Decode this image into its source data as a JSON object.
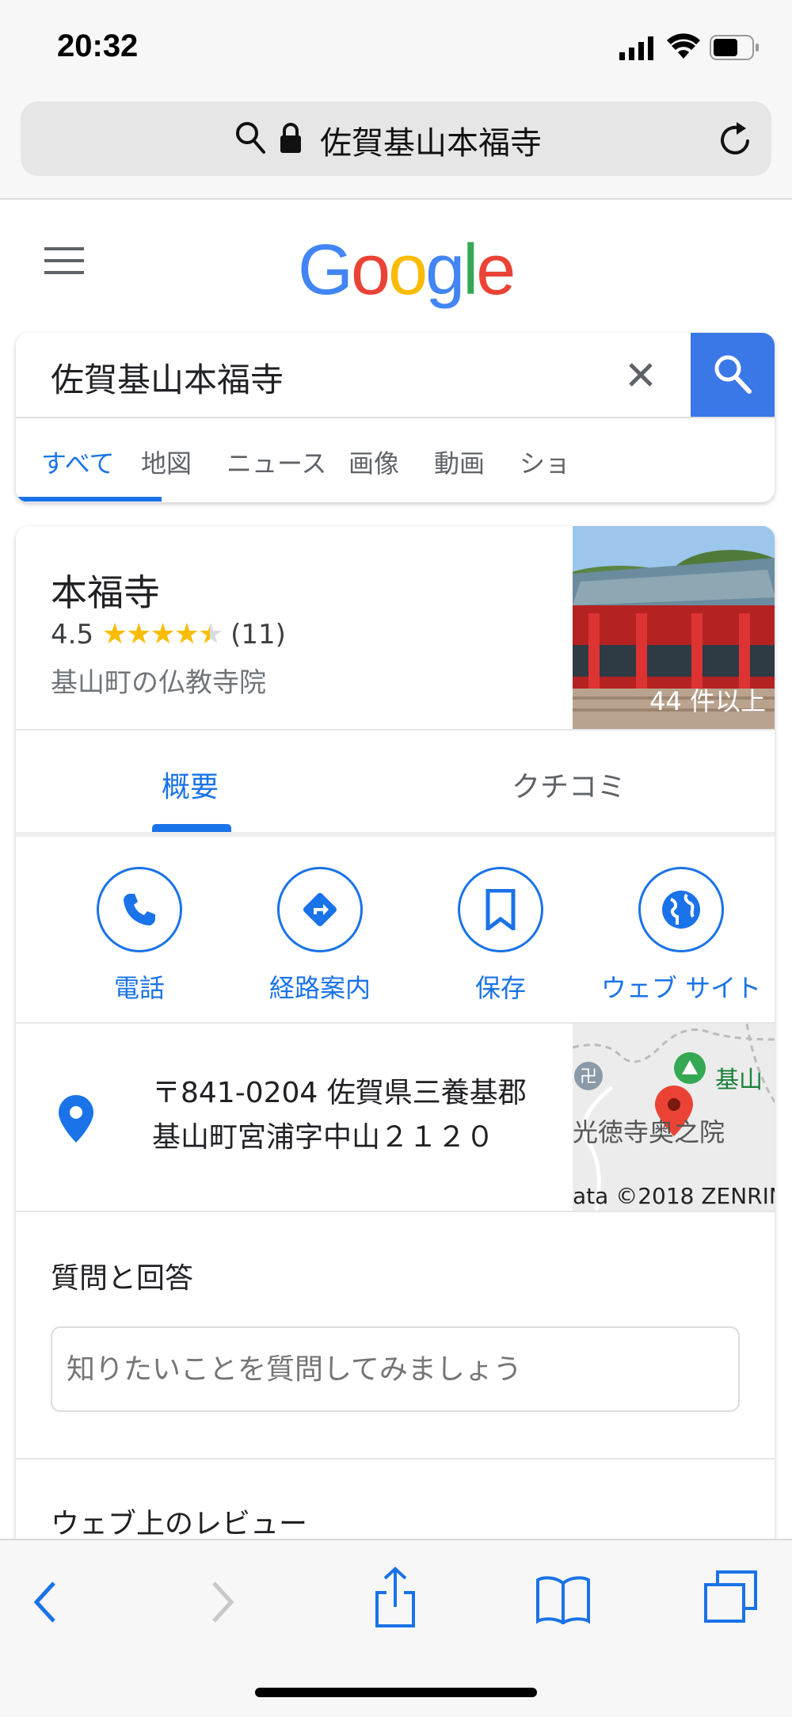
{
  "status": {
    "time": "20:32"
  },
  "browser": {
    "url_text": "佐賀基山本福寺"
  },
  "google": {
    "logo_letters": [
      "G",
      "o",
      "o",
      "g",
      "l",
      "e"
    ],
    "logo_colors": [
      "#4285F4",
      "#EA4335",
      "#FBBC05",
      "#4285F4",
      "#34A853",
      "#EA4335"
    ]
  },
  "search": {
    "query": "佐賀基山本福寺",
    "tabs": [
      {
        "label": "すべて",
        "active": true
      },
      {
        "label": "地図"
      },
      {
        "label": "ニュース"
      },
      {
        "label": "画像"
      },
      {
        "label": "動画"
      },
      {
        "label": "ショ"
      }
    ]
  },
  "entity": {
    "title": "本福寺",
    "rating": "4.5",
    "rating_stars": 4.5,
    "review_count": "(11)",
    "subtitle": "基山町の仏教寺院",
    "photo_count": "44 件以上",
    "subtabs": [
      {
        "label": "概要",
        "active": true
      },
      {
        "label": "クチコミ"
      }
    ],
    "actions": [
      {
        "label": "電話",
        "icon": "phone-icon"
      },
      {
        "label": "経路案内",
        "icon": "directions-icon"
      },
      {
        "label": "保存",
        "icon": "bookmark-icon"
      },
      {
        "label": "ウェブ サイト",
        "icon": "globe-icon"
      }
    ],
    "address_line1": "〒841-0204 佐賀県三養基郡",
    "address_line2": "基山町宮浦字中山２１２０",
    "map": {
      "label1": "基山",
      "label2": "光徳寺奥之院",
      "copyright": "ata ©2018 ZENRIN"
    },
    "qa_title": "質問と回答",
    "qa_placeholder": "知りたいことを質問してみましょう",
    "reviews_title": "ウェブ上のレビュー"
  },
  "colors": {
    "accent": "#1a73e8",
    "search_button": "#3b78e7",
    "star": "#fbbc04"
  }
}
